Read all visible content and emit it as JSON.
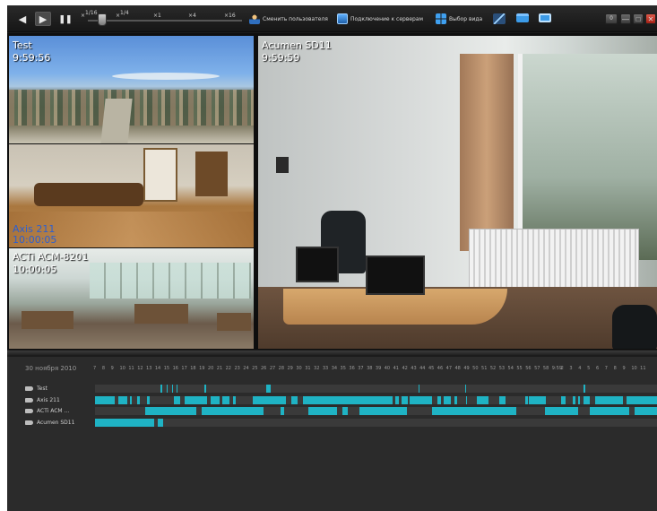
{
  "toolbar": {
    "speeds": [
      {
        "label": "×",
        "sup": "1/16"
      },
      {
        "label": "×",
        "sup": "1/4"
      },
      {
        "label": "×1",
        "sup": ""
      },
      {
        "label": "×4",
        "sup": ""
      },
      {
        "label": "×16",
        "sup": ""
      }
    ],
    "switch_user_label": "Сменить пользователя",
    "connect_servers_label": "Подключение к серверам",
    "view_select_label": "Выбор вида",
    "counter": "0"
  },
  "cameras": [
    {
      "name": "Test",
      "time": "9:59:56"
    },
    {
      "name": "Axis 211",
      "time": "10:00:05"
    },
    {
      "name": "ACTi ACM-8201",
      "time": "10:00:05"
    },
    {
      "name": "Acumen SD11",
      "time": "9:59:59"
    }
  ],
  "timeline": {
    "date": "30 ноября 2010",
    "hour_ticks": [
      "7",
      "8",
      "9",
      "10",
      "11",
      "12",
      "13",
      "14",
      "15",
      "16",
      "17",
      "18",
      "19",
      "20",
      "21",
      "22",
      "23",
      "24",
      "25",
      "26",
      "27",
      "28",
      "29",
      "30",
      "31",
      "32",
      "33",
      "34",
      "35",
      "36",
      "37",
      "38",
      "39",
      "40",
      "41",
      "42",
      "43",
      "44",
      "45",
      "46",
      "47",
      "48",
      "49",
      "50",
      "51",
      "52",
      "53",
      "54",
      "55",
      "56",
      "57",
      "58",
      "9:59",
      "2",
      "3",
      "4",
      "5",
      "6",
      "7",
      "8",
      "9",
      "10",
      "11"
    ],
    "rows": [
      {
        "name": "Test",
        "segments": [
          [
            0.117,
            0.119
          ],
          [
            0.127,
            0.129
          ],
          [
            0.137,
            0.139
          ],
          [
            0.145,
            0.147
          ],
          [
            0.195,
            0.197
          ],
          [
            0.305,
            0.312
          ],
          [
            0.575,
            0.578
          ],
          [
            0.658,
            0.661
          ],
          [
            0.87,
            0.872
          ]
        ]
      },
      {
        "name": "Axis 211",
        "segments": [
          [
            0.0,
            0.035
          ],
          [
            0.042,
            0.058
          ],
          [
            0.062,
            0.066
          ],
          [
            0.075,
            0.08
          ],
          [
            0.093,
            0.098
          ],
          [
            0.14,
            0.152
          ],
          [
            0.16,
            0.2
          ],
          [
            0.205,
            0.222
          ],
          [
            0.226,
            0.24
          ],
          [
            0.246,
            0.25
          ],
          [
            0.28,
            0.34
          ],
          [
            0.35,
            0.36
          ],
          [
            0.37,
            0.53
          ],
          [
            0.535,
            0.54
          ],
          [
            0.545,
            0.556
          ],
          [
            0.56,
            0.6
          ],
          [
            0.61,
            0.615
          ],
          [
            0.62,
            0.633
          ],
          [
            0.64,
            0.645
          ],
          [
            0.66,
            0.662
          ],
          [
            0.68,
            0.7
          ],
          [
            0.72,
            0.73
          ],
          [
            0.766,
            0.77
          ],
          [
            0.772,
            0.8
          ],
          [
            0.8,
            0.802
          ],
          [
            0.83,
            0.838
          ],
          [
            0.85,
            0.855
          ],
          [
            0.86,
            0.862
          ],
          [
            0.87,
            0.88
          ],
          [
            0.89,
            0.94
          ],
          [
            0.945,
            1.0
          ]
        ]
      },
      {
        "name": "ACTi ACM ...",
        "segments": [
          [
            0.09,
            0.18
          ],
          [
            0.19,
            0.3
          ],
          [
            0.33,
            0.336
          ],
          [
            0.38,
            0.43
          ],
          [
            0.44,
            0.45
          ],
          [
            0.47,
            0.555
          ],
          [
            0.6,
            0.75
          ],
          [
            0.8,
            0.86
          ],
          [
            0.88,
            0.95
          ],
          [
            0.96,
            1.0
          ]
        ]
      },
      {
        "name": "Acumen SD11",
        "segments": [
          [
            0.0,
            0.105
          ],
          [
            0.112,
            0.122
          ]
        ]
      }
    ]
  }
}
